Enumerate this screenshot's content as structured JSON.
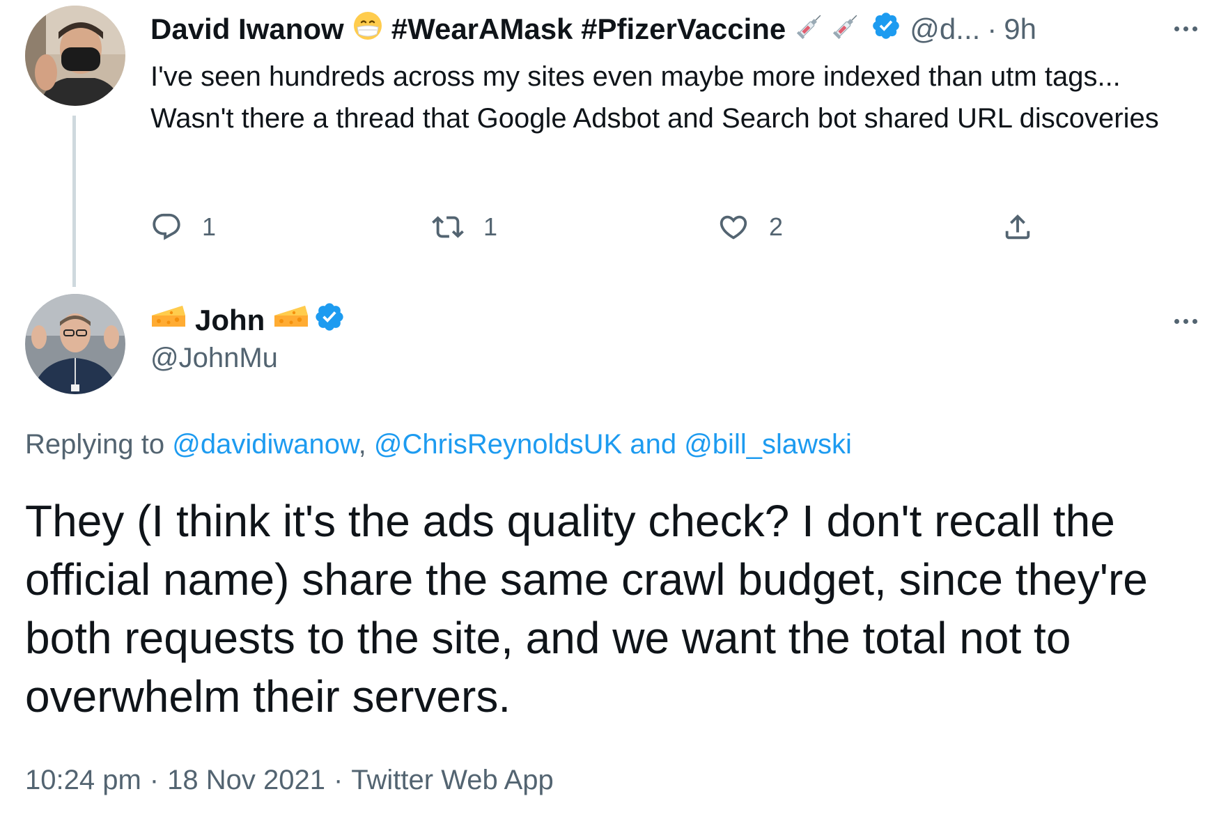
{
  "parent_tweet": {
    "author": {
      "display_name": "David Iwanow",
      "hashtags": "#WearAMask #PfizerVaccine",
      "handle_truncated": "@d...",
      "emojis": [
        "mask-face-emoji",
        "syringe-emoji",
        "syringe-emoji"
      ],
      "verified": true
    },
    "separator": "·",
    "time_ago": "9h",
    "text": "I've seen hundreds across my sites even maybe more indexed than utm tags... Wasn't there a thread that Google Adsbot and Search bot shared URL discoveries",
    "actions": {
      "replies": "1",
      "retweets": "1",
      "likes": "2"
    }
  },
  "main_tweet": {
    "author": {
      "display_name": "John",
      "handle": "@JohnMu",
      "emojis": [
        "cheese-emoji",
        "cheese-emoji"
      ],
      "verified": true
    },
    "replying": {
      "prefix": "Replying to",
      "mention_1": "@davidiwanow",
      "comma": ",",
      "mention_2": "@ChrisReynoldsUK",
      "and": "and",
      "mention_3": "@bill_slawski"
    },
    "text": "They (I think it's the ads quality check? I don't recall the official name) share the same crawl budget, since they're both requests to the site, and we want the total not to overwhelm their servers.",
    "meta": {
      "time": "10:24 pm",
      "date": "18 Nov 2021",
      "source": "Twitter Web App",
      "separator": "·"
    }
  },
  "colors": {
    "text_primary": "#0f1419",
    "text_secondary": "#536471",
    "link": "#1d9bf0",
    "verified": "#1d9bf0",
    "thread_line": "#cfd9de"
  }
}
